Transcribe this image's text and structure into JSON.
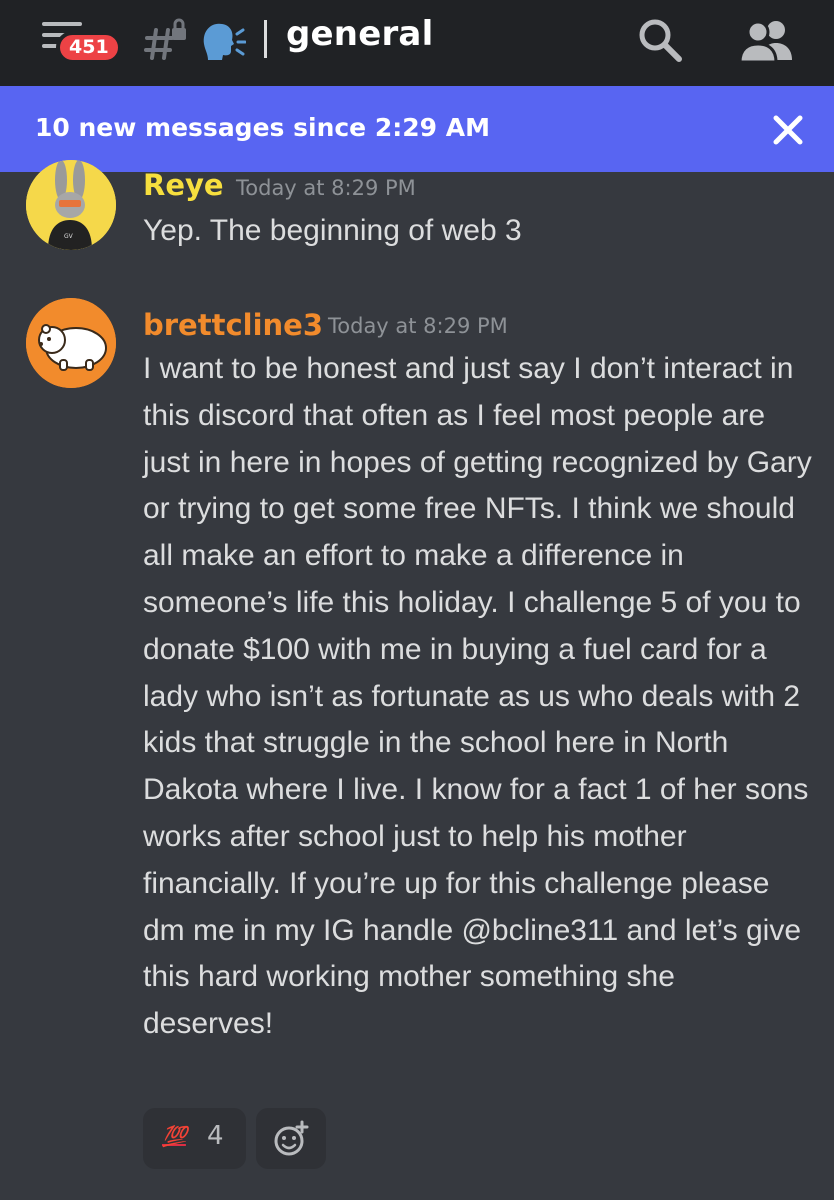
{
  "header": {
    "unread_count": "451",
    "channel_name": "general",
    "separator": "|",
    "channel_emoji": "speaking-head-emoji",
    "icons": [
      "hamburger-icon",
      "locked-hash-icon",
      "search-icon",
      "members-icon"
    ]
  },
  "banner": {
    "text": "10 new messages since 2:29 AM",
    "close_icon": "close-icon"
  },
  "messages": [
    {
      "username": "Reye",
      "timestamp": "Today at 8:29 PM",
      "text": "Yep. The beginning of web 3"
    },
    {
      "username": "brettcline3",
      "timestamp": "Today at 8:29 PM",
      "text": "I want to be honest and just say I don’t interact in this discord that often as I feel most people are just in here in hopes of getting recognized by Gary or trying to get some free NFTs. I think we should all make an effort to make a difference in someone’s life this holiday. I challenge 5 of you to donate $100 with me in buying a fuel card for a lady who isn’t as fortunate as us who deals with 2 kids that struggle in the school here in North Dakota where I live. I know for a fact 1 of her sons works after school  just to help his mother financially. If you’re up for this challenge please dm me in my IG handle @bcline311 and let’s give this hard working mother something she deserves!",
      "reactions": [
        {
          "emoji": "💯",
          "count": "4"
        }
      ]
    }
  ],
  "colors": {
    "background": "#36393f",
    "topbar": "#202225",
    "banner": "#5865f2",
    "badge": "#ed4245",
    "reye_name": "#f7df3e",
    "brett_name": "#f28b2c",
    "timestamp": "#8e9297"
  }
}
